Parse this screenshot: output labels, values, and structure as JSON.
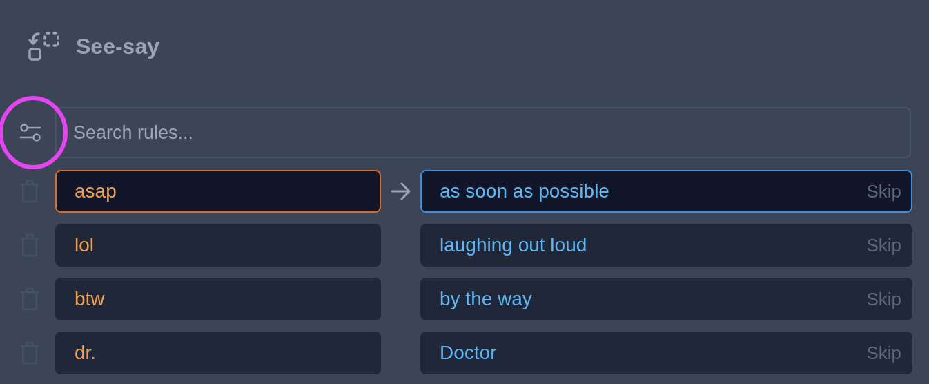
{
  "header": {
    "title": "See-say"
  },
  "search": {
    "placeholder": "Search rules..."
  },
  "rules": [
    {
      "from": "asap",
      "to": "as soon as possible",
      "skip": "Skip",
      "selected": true
    },
    {
      "from": "lol",
      "to": "laughing out loud",
      "skip": "Skip",
      "selected": false
    },
    {
      "from": "btw",
      "to": "by the way",
      "skip": "Skip",
      "selected": false
    },
    {
      "from": "dr.",
      "to": "Doctor",
      "skip": "Skip",
      "selected": false
    }
  ]
}
